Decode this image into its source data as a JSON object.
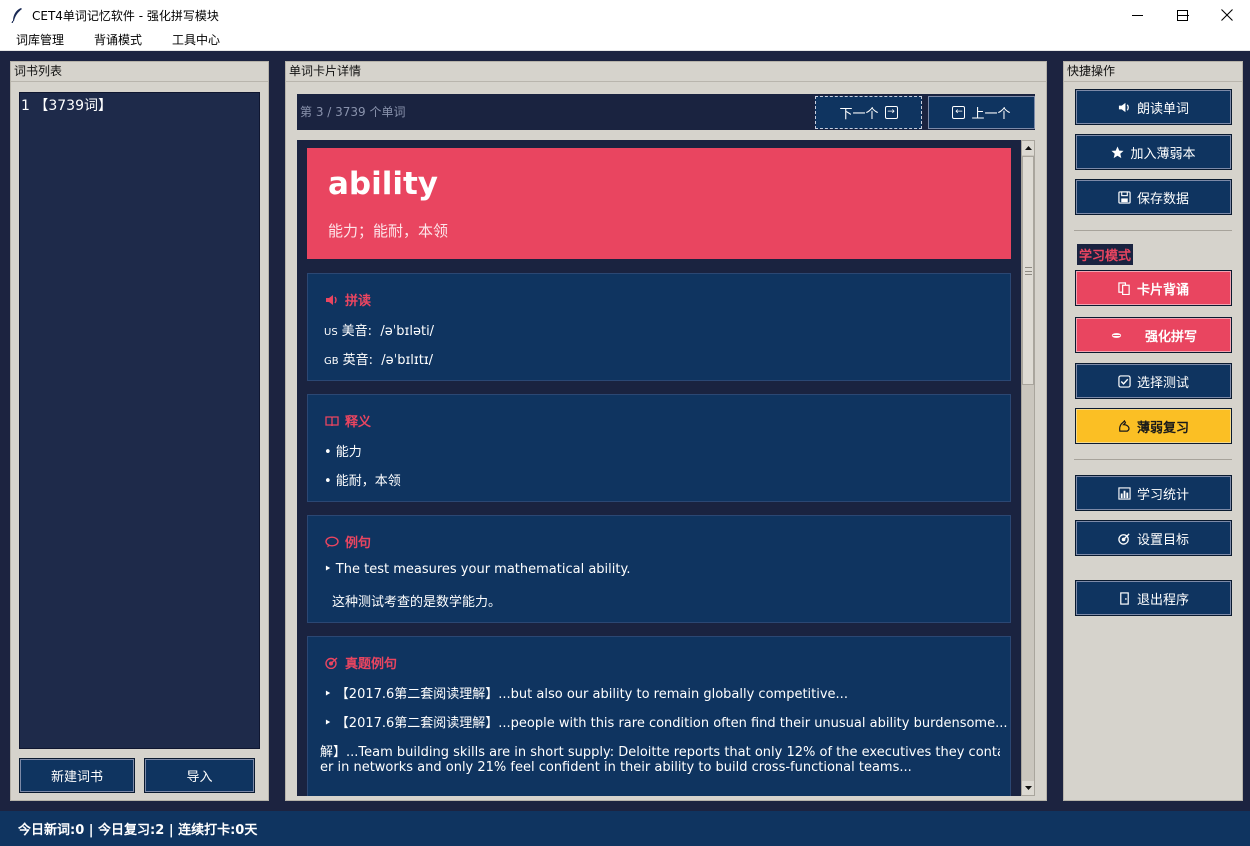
{
  "window": {
    "title": "CET4单词记忆软件 - 强化拼写模块"
  },
  "menu": {
    "items": [
      "词库管理",
      "背诵模式",
      "工具中心"
    ]
  },
  "left": {
    "title": "词书列表",
    "books": [
      "1 【3739词】"
    ],
    "new_button": "新建词书",
    "import_button": "导入"
  },
  "middle": {
    "title": "单词卡片详情",
    "counter": "第 3 / 3739 个单词",
    "next_button": "下一个",
    "prev_button": "上一个",
    "word": "ability",
    "short_meaning": "能力；能耐，本领",
    "pronunciation": {
      "title": "拼读",
      "us_tag": "US",
      "us_label": "美音:",
      "us_ipa": "/əˈbɪləti/",
      "gb_tag": "GB",
      "gb_label": "英音:",
      "gb_ipa": "/əˈbɪlɪtɪ/"
    },
    "definition": {
      "title": "释义",
      "items": [
        "• 能力",
        "• 能耐，本领"
      ]
    },
    "example": {
      "title": "例句",
      "en": "‣  The test measures your mathematical ability.",
      "zh": "这种测试考查的是数学能力。"
    },
    "exam": {
      "title": "真题例句",
      "items": [
        "‣  【2017.6第二套阅读理解】...but also our ability to remain globally competitive...",
        "‣  【2017.6第二套阅读理解】...people with this rare condition often find their unusual ability burdensome...",
        "解】...Team building skills are in short supply: Deloitte reports that only 12% of the executives they contacted t",
        "er in networks and only 21% feel confident in their ability to build cross-functional teams..."
      ]
    }
  },
  "right": {
    "title": "快捷操作",
    "read_button": "朗读单词",
    "weak_add_button": "加入薄弱本",
    "save_button": "保存数据",
    "mode_label": "学习模式",
    "card_button": "卡片背诵",
    "spell_button": "强化拼写",
    "quiz_button": "选择测试",
    "weak_review_button": "薄弱复习",
    "stats_button": "学习统计",
    "goal_button": "设置目标",
    "exit_button": "退出程序"
  },
  "status": {
    "text": "今日新词:0 | 今日复习:2 | 连续打卡:0天"
  },
  "colors": {
    "accent": "#e94560",
    "navy": "#0f3460",
    "dark": "#1a2340",
    "yellow": "#fbbf24"
  }
}
